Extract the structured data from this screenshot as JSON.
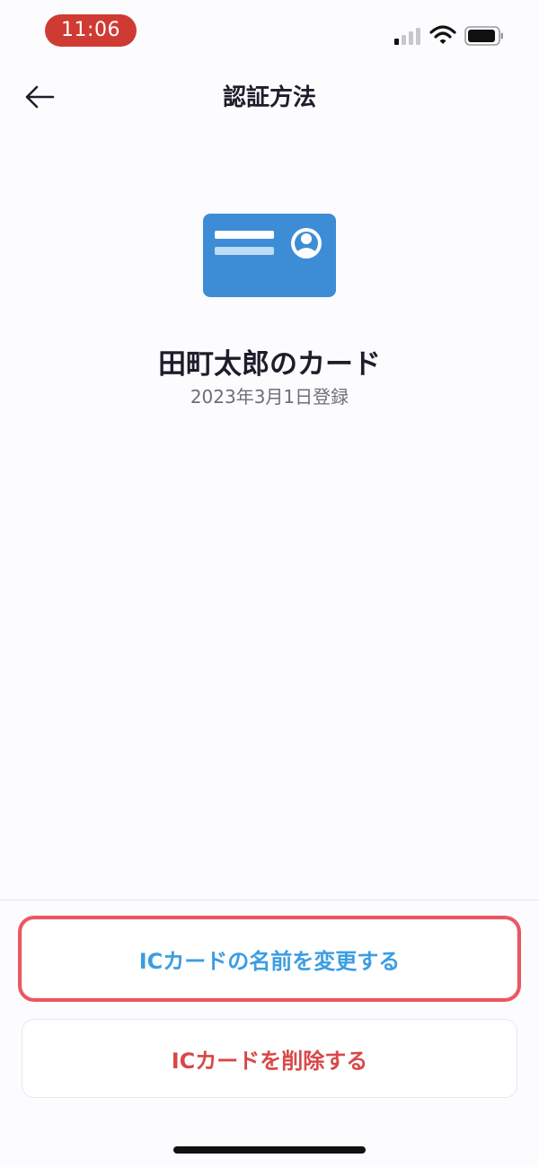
{
  "status_bar": {
    "time": "11:06",
    "signal_icon": "cellular-signal-icon",
    "wifi_icon": "wifi-icon",
    "battery_icon": "battery-icon"
  },
  "header": {
    "title": "認証方法",
    "back_icon": "arrow-left-icon"
  },
  "card": {
    "icon": "id-card-icon",
    "icon_color": "#3d8dd6",
    "name": "田町太郎のカード",
    "registered": "2023年3月1日登録"
  },
  "actions": {
    "rename_label": "ICカードの名前を変更する",
    "rename_color": "#3b9de2",
    "delete_label": "ICカードを削除する",
    "delete_color": "#d84848",
    "highlight_color": "#ee5562"
  }
}
